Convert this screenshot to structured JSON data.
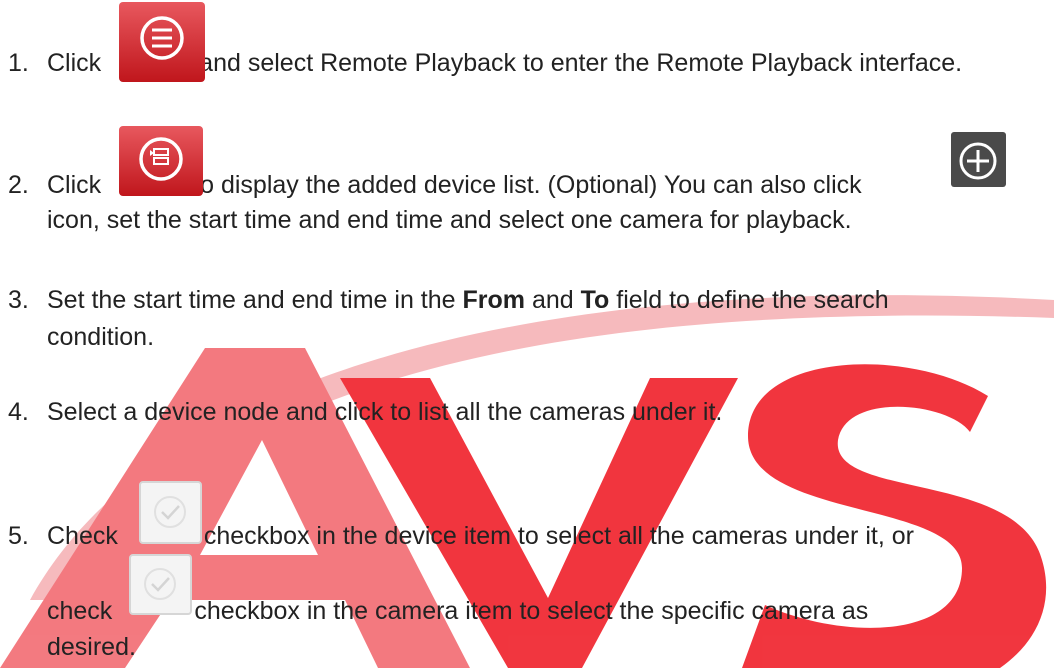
{
  "watermark": {
    "text": "AVS",
    "color": "#f0202a"
  },
  "steps": [
    {
      "num": "1.",
      "before": "Click",
      "after": "and select Remote Playback to enter the Remote Playback interface.",
      "icon": "menu-icon"
    },
    {
      "num": "2.",
      "before": "Click",
      "after": "to display the added device list. (Optional) You can also click",
      "cont": "icon, set the start time and end time and select one camera for playback.",
      "icons": [
        "device-list-icon",
        "add-time-icon"
      ]
    },
    {
      "num": "3.",
      "before": "Set the start time and end time in the",
      "bold1": "From",
      "mid": "and",
      "bold2": "To",
      "after": "field to define the search",
      "cont": "condition."
    },
    {
      "num": "4.",
      "text": "Select a device node and click to list all the cameras under it."
    },
    {
      "num": "5.",
      "before": "Check",
      "after": "checkbox in the device item to select all the cameras under it, or",
      "cont_before": "check",
      "cont_after": "checkbox in the camera item to select the specific camera as",
      "cont2": "desired.",
      "icon": "checkbox-icon"
    }
  ]
}
